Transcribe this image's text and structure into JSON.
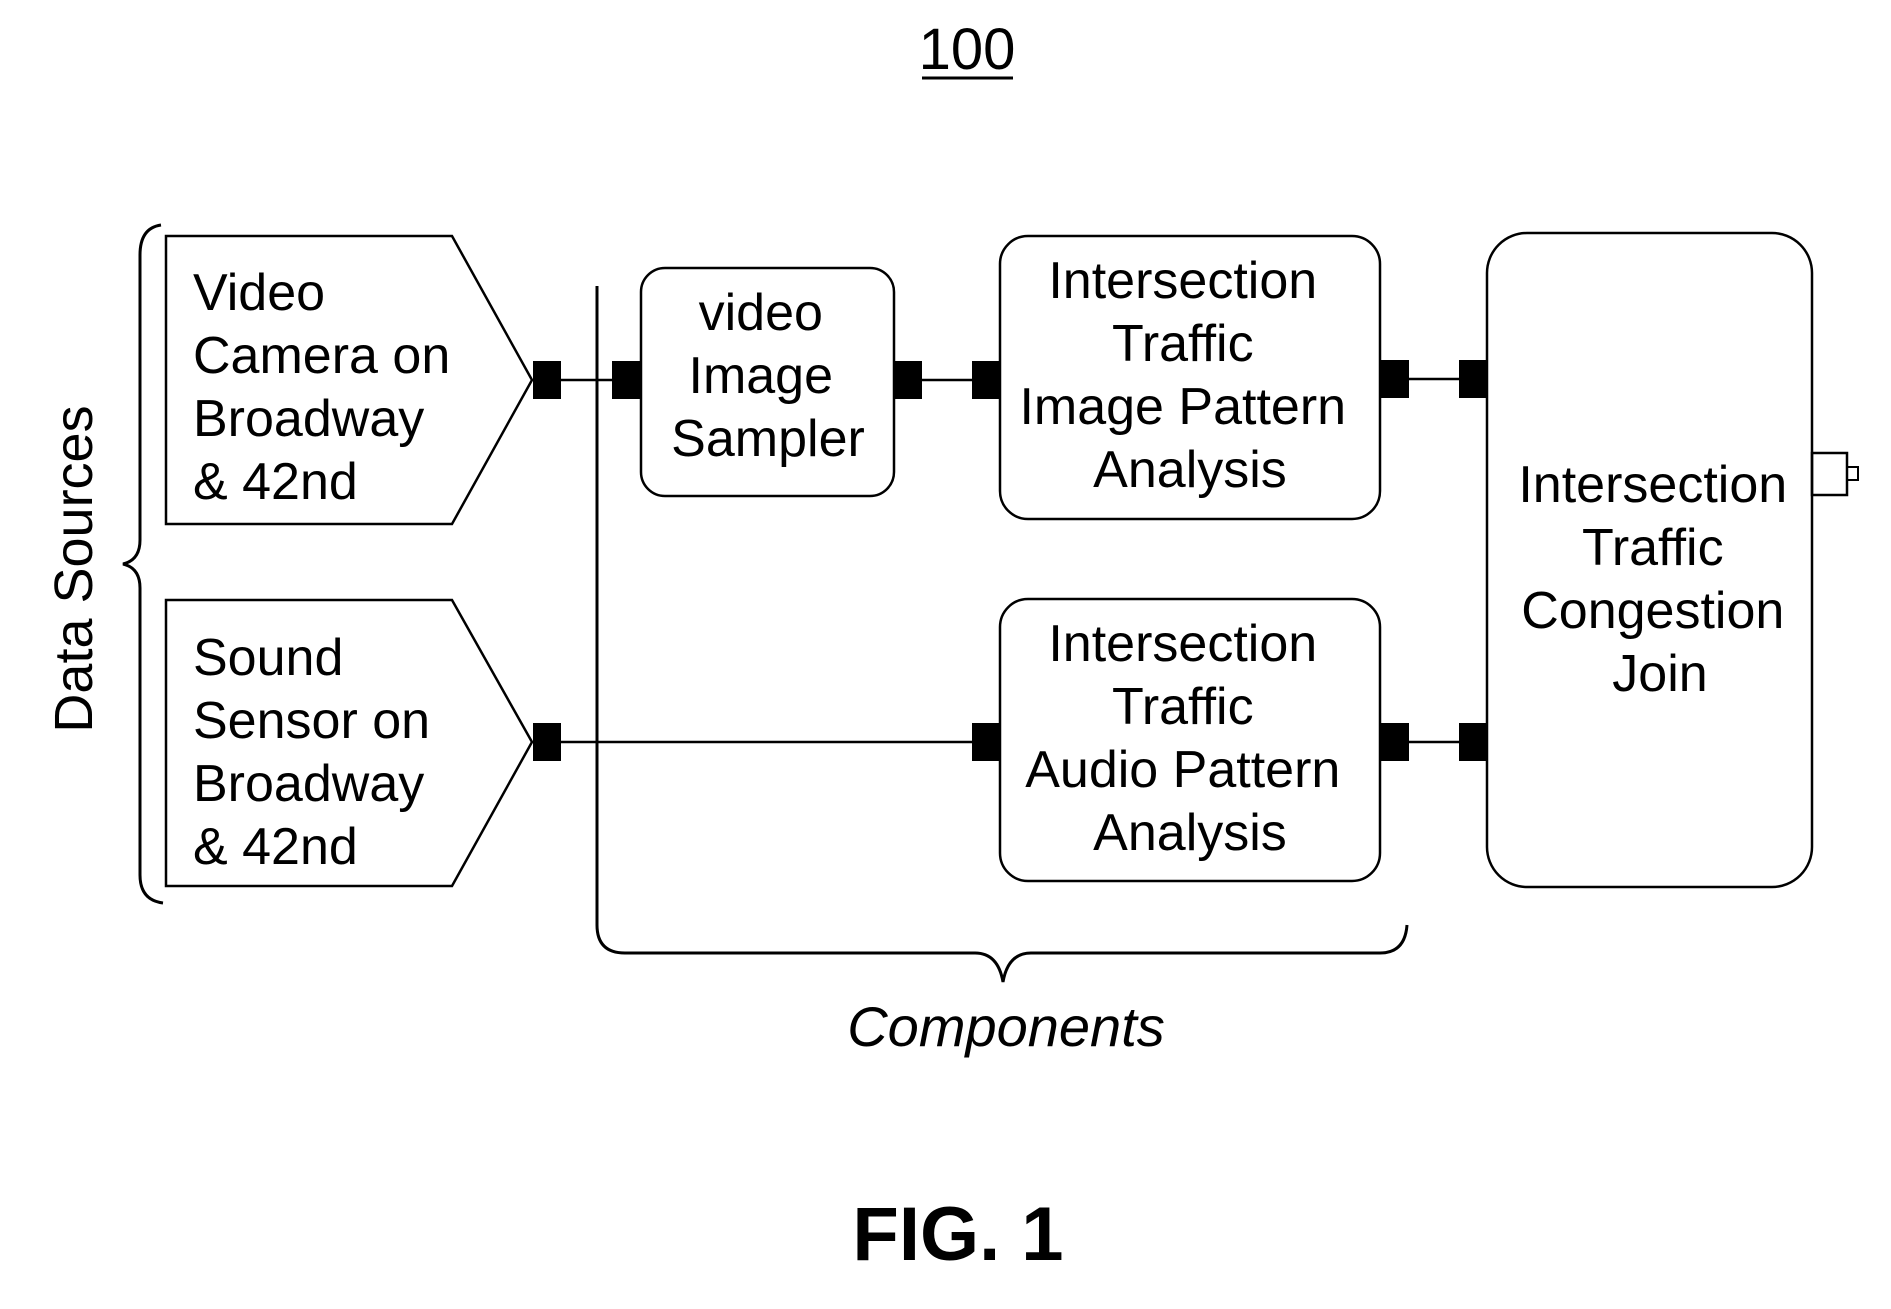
{
  "figure": {
    "reference_number": "100",
    "caption": "FIG. 1",
    "group_labels": {
      "data_sources": "Data Sources",
      "components": "Components"
    }
  },
  "data_sources": [
    {
      "id": "video-camera",
      "lines": [
        "Video",
        "Camera on",
        "Broadway",
        "& 42nd"
      ]
    },
    {
      "id": "sound-sensor",
      "lines": [
        "Sound",
        "Sensor on",
        "Broadway",
        "& 42nd"
      ]
    }
  ],
  "components": [
    {
      "id": "video-image-sampler",
      "lines": [
        "video",
        "Image",
        "Sampler"
      ]
    },
    {
      "id": "image-pattern-analysis",
      "lines": [
        "Intersection",
        "Traffic",
        "Image Pattern",
        "Analysis"
      ]
    },
    {
      "id": "audio-pattern-analysis",
      "lines": [
        "Intersection",
        "Traffic",
        "Audio Pattern",
        "Analysis"
      ]
    }
  ],
  "join": {
    "id": "congestion-join",
    "lines": [
      "Intersection",
      "Traffic",
      "Congestion",
      "Join"
    ]
  },
  "connections": [
    {
      "from": "video-camera",
      "to": "video-image-sampler"
    },
    {
      "from": "video-image-sampler",
      "to": "image-pattern-analysis"
    },
    {
      "from": "image-pattern-analysis",
      "to": "congestion-join"
    },
    {
      "from": "sound-sensor",
      "to": "audio-pattern-analysis"
    },
    {
      "from": "audio-pattern-analysis",
      "to": "congestion-join"
    }
  ]
}
